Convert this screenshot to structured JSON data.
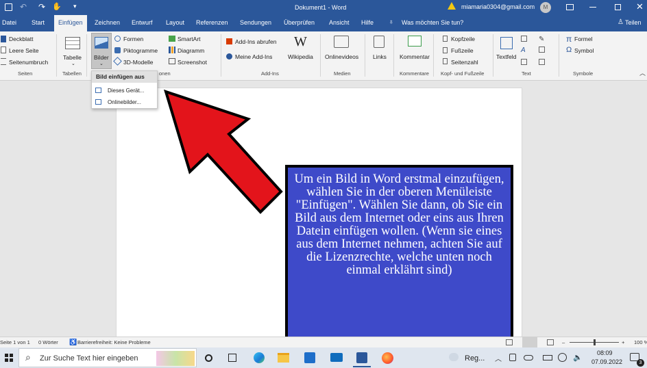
{
  "titlebar": {
    "doc_title": "Dokument1 - Word",
    "account": "miamaria0304@gmail.com",
    "avatar_initial": "M"
  },
  "tabs": [
    "Datei",
    "Start",
    "Einfügen",
    "Zeichnen",
    "Entwurf",
    "Layout",
    "Referenzen",
    "Sendungen",
    "Überprüfen",
    "Ansicht",
    "Hilfe"
  ],
  "tell_me": "Was möchten Sie tun?",
  "share": "Teilen",
  "ribbon": {
    "pages": {
      "items": [
        "Deckblatt",
        "Leere Seite",
        "Seitenumbruch"
      ],
      "group": "Seiten"
    },
    "tables": {
      "label": "Tabelle",
      "group": "Tabellen"
    },
    "pictures": {
      "label": "Bilder",
      "shapes": "Formen",
      "icons": "Piktogramme",
      "models": "3D-Modelle",
      "smartart": "SmartArt",
      "chart": "Diagramm",
      "screenshot": "Screenshot",
      "group_tail": "onen"
    },
    "addins": {
      "get": "Add-Ins abrufen",
      "mine": "Meine Add-Ins",
      "wikipedia": "Wikipedia",
      "group": "Add-Ins"
    },
    "media": {
      "video": "Onlinevideos",
      "group": "Medien"
    },
    "links": {
      "label": "Links"
    },
    "comments": {
      "label": "Kommentar",
      "group": "Kommentare"
    },
    "headerfooter": {
      "header": "Kopfzeile",
      "footer": "Fußzeile",
      "pagenum": "Seitenzahl",
      "group": "Kopf- und Fußzeile"
    },
    "text": {
      "textbox": "Textfeld",
      "group": "Text"
    },
    "symbols": {
      "formula": "Formel",
      "symbol": "Symbol",
      "group": "Symbole"
    }
  },
  "dropdown": {
    "header": "Bild einfügen aus",
    "items": [
      "Dieses Gerät...",
      "Onlinebilder..."
    ]
  },
  "callout": "Um ein Bild in Word erstmal einzufügen, wählen Sie in der oberen Menüleiste \"Einfügen\". Wählen Sie dann, ob Sie ein Bild aus dem Internet oder eins aus Ihren Datein einfügen wollen. (Wenn sie eines aus dem Internet nehmen, achten Sie auf die Lizenzrechte, welche unten noch einmal erklährt sind)",
  "status": {
    "page": "Seite 1 von 1",
    "words": "0 Wörter",
    "accessibility": "Barrierefreiheit: Keine Probleme",
    "zoom": "100 %"
  },
  "taskbar": {
    "search_placeholder": "Zur Suche Text hier eingeben",
    "weather": "Reg...",
    "time": "08:09",
    "date": "07.09.2022",
    "notifications": "3"
  },
  "colors": {
    "word_blue": "#2b579a",
    "callout_bg": "#3e4ac9",
    "arrow_red": "#e3141b"
  }
}
